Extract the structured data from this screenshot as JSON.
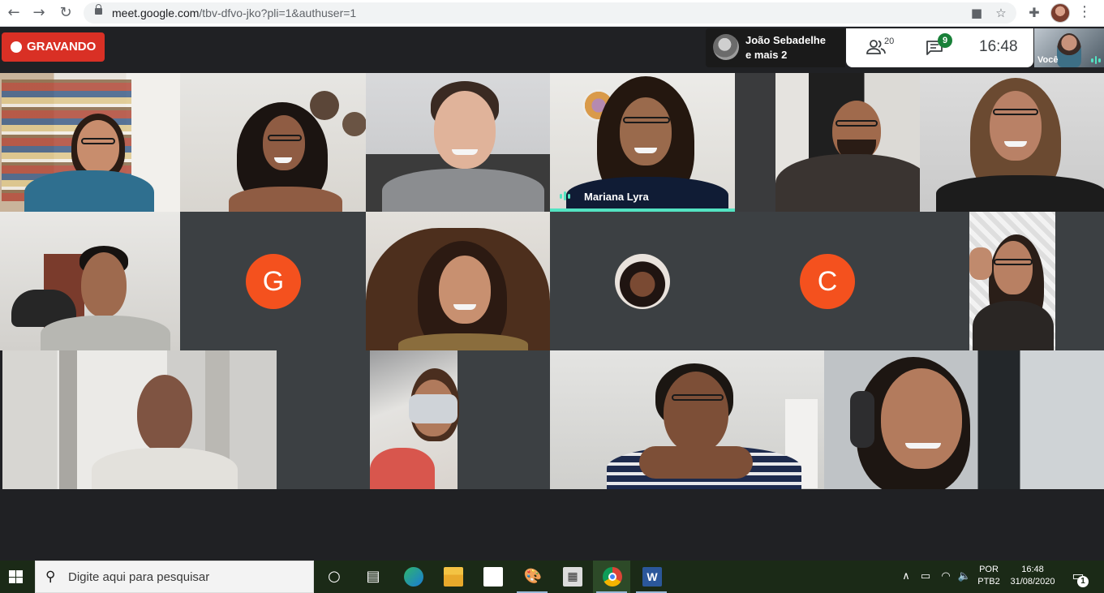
{
  "browser": {
    "url_host": "meet.google.com",
    "url_path": "/tbv-dfvo-jko?pli=1&authuser=1",
    "back_icon": "arrow-left-icon",
    "forward_icon": "arrow-right-icon",
    "reload_icon": "reload-icon",
    "camera_icon": "video-camera-icon",
    "star_icon": "star-icon",
    "extensions_icon": "puzzle-icon",
    "menu_icon": "more-vert-icon"
  },
  "meet": {
    "recording_label": "GRAVANDO",
    "presenter_line1": "João Sebadelhe",
    "presenter_line2": "e mais 2",
    "people_count": "20",
    "chat_count": "9",
    "time": "16:48",
    "self_label": "Você",
    "speaker_name": "Mariana Lyra",
    "avatar_letters": [
      "G",
      "C"
    ],
    "accent_color": "#53e3c2",
    "recording_color": "#d93025",
    "letter_avatar_color": "#f4511e"
  },
  "taskbar": {
    "search_placeholder": "Digite aqui para pesquisar",
    "language_line1": "POR",
    "language_line2": "PTB2",
    "clock_time": "16:48",
    "clock_date": "31/08/2020",
    "notification_count": "1"
  }
}
